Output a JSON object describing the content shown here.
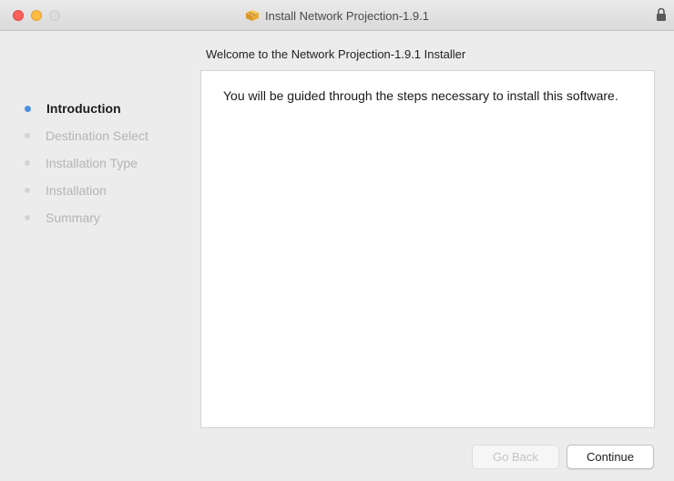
{
  "window": {
    "title": "Install Network Projection-1.9.1"
  },
  "heading": "Welcome to the Network Projection-1.9.1 Installer",
  "sidebar": {
    "steps": [
      {
        "label": "Introduction",
        "active": true
      },
      {
        "label": "Destination Select",
        "active": false
      },
      {
        "label": "Installation Type",
        "active": false
      },
      {
        "label": "Installation",
        "active": false
      },
      {
        "label": "Summary",
        "active": false
      }
    ]
  },
  "content": {
    "text": "You will be guided through the steps necessary to install this software."
  },
  "buttons": {
    "back": "Go Back",
    "continue": "Continue"
  },
  "icons": {
    "package": "package-icon",
    "lock": "lock-icon"
  },
  "colors": {
    "close": "#fc605c",
    "minimize": "#fdbc40",
    "active_dot": "#4a90e2"
  }
}
